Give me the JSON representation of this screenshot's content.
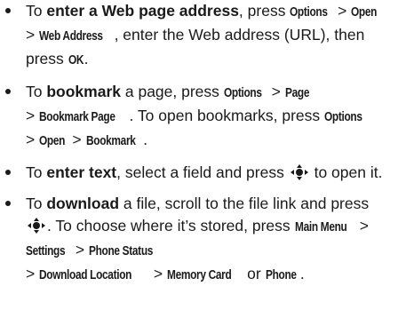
{
  "items": [
    {
      "t1": "To ",
      "b1": "enter a Web page address",
      "t2": ", press ",
      "k1": "Options",
      "t3": " > ",
      "k2": "Open",
      "t4": "> ",
      "k3": "Web Address",
      "t5": ", enter the Web address (URL), then press ",
      "k4": "OK",
      "t6": "."
    },
    {
      "t1": "To ",
      "b1": "bookmark",
      "t2": " a page, press ",
      "k1": "Options",
      "t3": " > ",
      "k2": "Page",
      "t4": "> ",
      "k3": "Bookmark Page",
      "t5": ". To open bookmarks, press ",
      "k4": "Options",
      "t6": "> ",
      "k5": "Open",
      "t7": " > ",
      "k6": "Bookmark",
      "t8": "."
    },
    {
      "t1": "To ",
      "b1": "enter text",
      "t2": ", select a field and press ",
      "t3": " to open it."
    },
    {
      "t1": "To ",
      "b1": "download",
      "t2": " a file, scroll to the file link and press ",
      "t3": ". To choose where it’s stored, press ",
      "k1": "Main Menu",
      "t4": " > ",
      "k2": "Settings",
      "t5": " > ",
      "k3": "Phone Status",
      "t6": "> ",
      "k4": "Download Location",
      "t7": " > ",
      "k5": "Memory Card",
      "t8": " or ",
      "k6": "Phone",
      "t9": "."
    }
  ],
  "icons": {
    "nav_key": "navigation-key-center-select-icon"
  }
}
